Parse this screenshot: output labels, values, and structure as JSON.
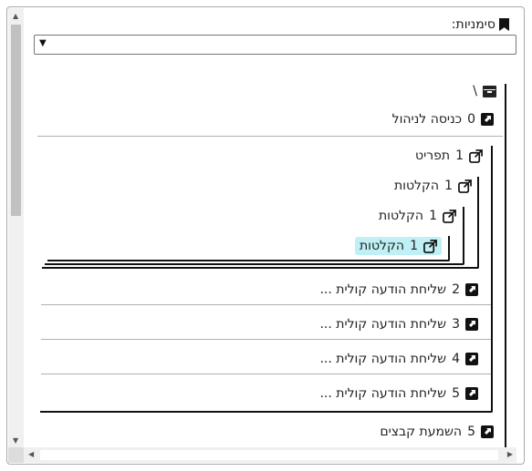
{
  "header": {
    "label": "סימניות:"
  },
  "select": {
    "value": ""
  },
  "root": {
    "label": "\\"
  },
  "items": [
    {
      "num": "0",
      "label": "כניסה לניהול"
    },
    {
      "num": "1",
      "label": "תפריט"
    },
    {
      "num": "1",
      "label": "הקלטות"
    },
    {
      "num": "1",
      "label": "הקלטות"
    },
    {
      "num": "1",
      "label": "הקלטות"
    },
    {
      "num": "2",
      "label": "שליחת הודעה קולית ..."
    },
    {
      "num": "3",
      "label": "שליחת הודעה קולית ..."
    },
    {
      "num": "4",
      "label": "שליחת הודעה קולית ..."
    },
    {
      "num": "5",
      "label": "שליחת הודעה קולית ..."
    },
    {
      "num": "5",
      "label": "השמעת קבצים"
    }
  ],
  "colors": {
    "highlight": "#bff0f5",
    "accent": "#111111"
  }
}
